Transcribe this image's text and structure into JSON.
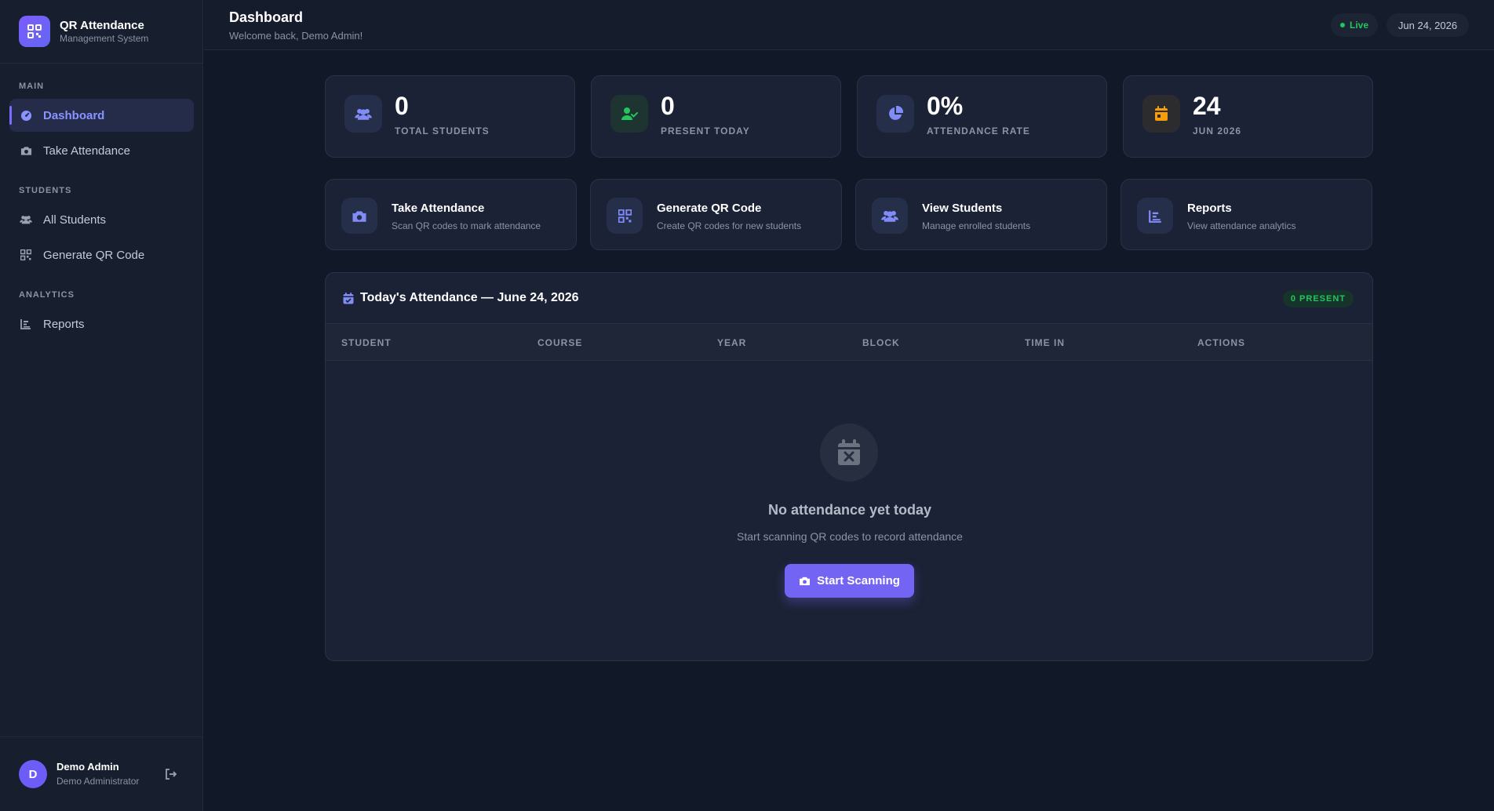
{
  "brand": {
    "title": "QR Attendance",
    "subtitle": "Management System"
  },
  "sidebar": {
    "sections": [
      {
        "label": "MAIN"
      },
      {
        "label": "STUDENTS"
      },
      {
        "label": "ANALYTICS"
      }
    ],
    "items": [
      {
        "label": "Dashboard",
        "icon": "dashboard-icon",
        "active": true
      },
      {
        "label": "Take Attendance",
        "icon": "camera-icon"
      },
      {
        "label": "All Students",
        "icon": "users-icon"
      },
      {
        "label": "Generate QR Code",
        "icon": "qr-icon"
      },
      {
        "label": "Reports",
        "icon": "chart-icon"
      }
    ]
  },
  "user": {
    "initial": "D",
    "name": "Demo Admin",
    "role": "Demo Administrator"
  },
  "header": {
    "title": "Dashboard",
    "subtitle": "Welcome back, Demo Admin!",
    "live_label": "Live",
    "date": "Jun 24, 2026"
  },
  "stats": [
    {
      "value": "0",
      "label": "TOTAL STUDENTS",
      "icon": "users-icon",
      "color": "#818cf8"
    },
    {
      "value": "0",
      "label": "PRESENT TODAY",
      "icon": "user-check-icon",
      "color": "#22c55e"
    },
    {
      "value": "0%",
      "label": "ATTENDANCE RATE",
      "icon": "pie-chart-icon",
      "color": "#818cf8"
    },
    {
      "value": "24",
      "label": "JUN 2026",
      "icon": "calendar-icon",
      "color": "#f59e0b"
    }
  ],
  "actions": [
    {
      "title": "Take Attendance",
      "subtitle": "Scan QR codes to mark attendance",
      "icon": "camera-icon"
    },
    {
      "title": "Generate QR Code",
      "subtitle": "Create QR codes for new students",
      "icon": "qr-icon"
    },
    {
      "title": "View Students",
      "subtitle": "Manage enrolled students",
      "icon": "users-icon"
    },
    {
      "title": "Reports",
      "subtitle": "View attendance analytics",
      "icon": "chart-icon"
    }
  ],
  "attendance": {
    "title": "Today's Attendance — June 24, 2026",
    "badge": "0 PRESENT",
    "columns": [
      "STUDENT",
      "COURSE",
      "YEAR",
      "BLOCK",
      "TIME IN",
      "ACTIONS"
    ],
    "empty_title": "No attendance yet today",
    "empty_subtitle": "Start scanning QR codes to record attendance",
    "button_label": "Start Scanning"
  },
  "colors": {
    "accent": "#7464f4",
    "success": "#22c55e",
    "warning": "#f59e0b"
  }
}
